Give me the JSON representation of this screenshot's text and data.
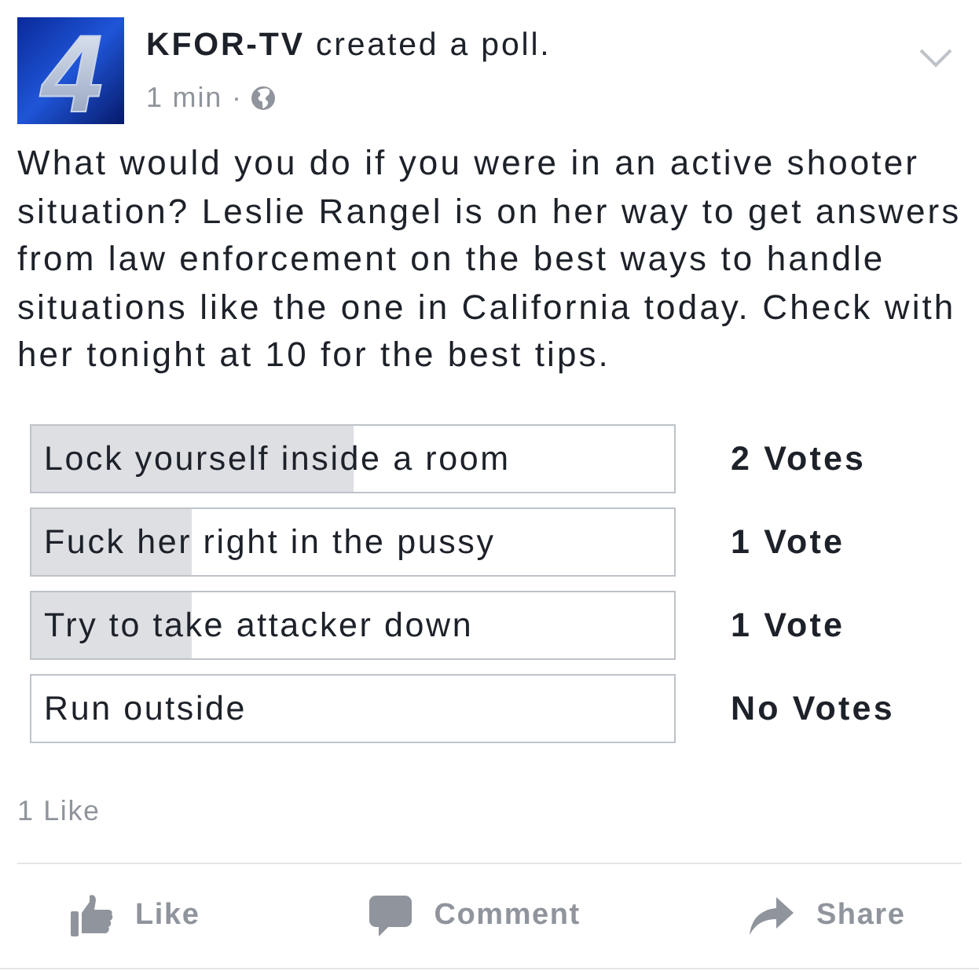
{
  "post": {
    "logo_text": "4",
    "author_line": "**KFOR-TV** created a poll.",
    "time": "1 min",
    "separator": "·",
    "text": "What would you do if you were in an active shooter situation? Leslie Rangel is on her way to get answers from law enforcement on the best ways to handle situations like the one in California today. Check with her tonight at 10 for the best tips."
  },
  "poll": {
    "options": [
      {
        "label": "Lock yourself inside a room",
        "level": 0.5,
        "votes": "2 Votes"
      },
      {
        "label": "Fuck her right in the pussy",
        "level": 0.25,
        "votes": "1 Vote"
      },
      {
        "label": "Try to take attacker down",
        "level": 0.25,
        "votes": "1 Vote"
      },
      {
        "label": "Run outside",
        "votes": "No Votes"
      }
    ]
  },
  "likes": "1 Like",
  "actions": [
    {
      "kind": "like",
      "label": "Like"
    },
    {
      "kind": "comment",
      "label": "Comment"
    },
    {
      "kind": "share",
      "label": "Share"
    }
  ]
}
